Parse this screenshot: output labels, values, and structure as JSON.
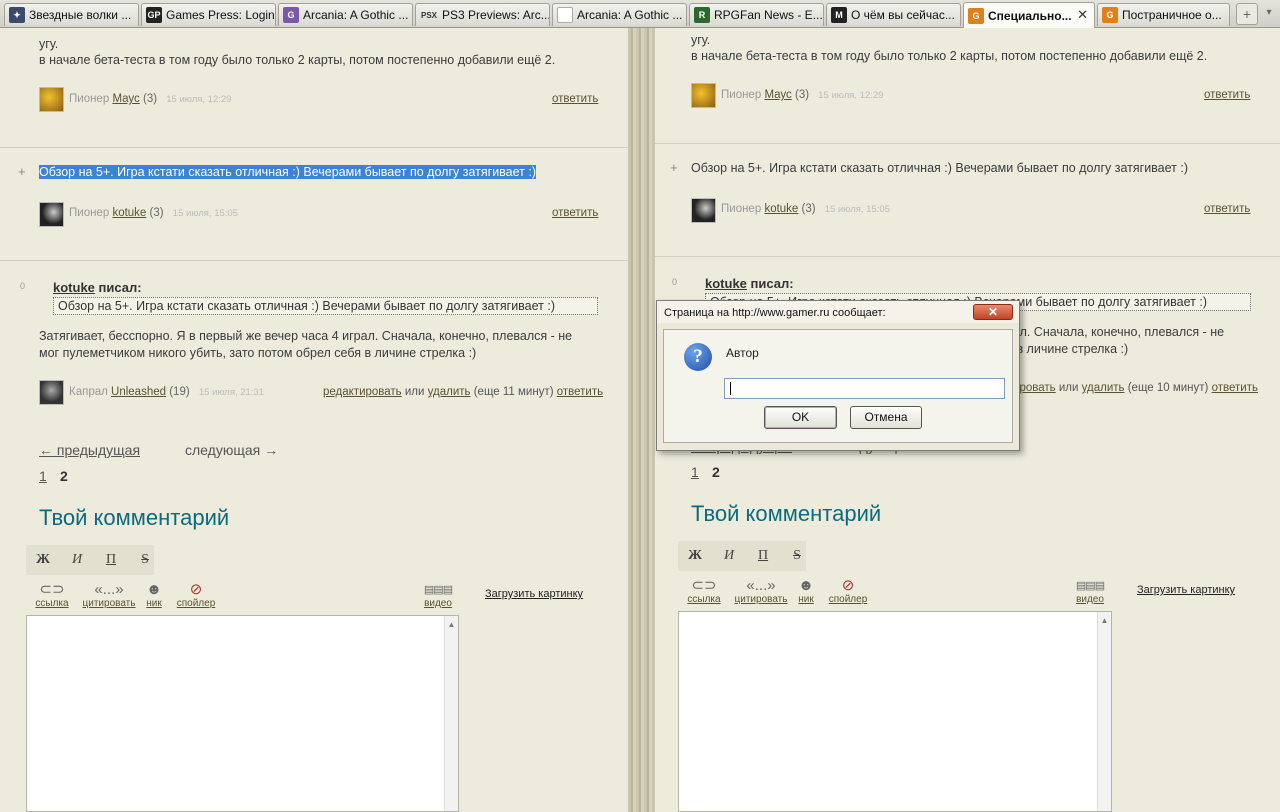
{
  "tabs": [
    {
      "title": "Звездные волки ...",
      "icon": "star-wolves-favicon-icon"
    },
    {
      "title": "Games Press: Login",
      "icon": "games-press-favicon-icon"
    },
    {
      "title": "Arcania: A Gothic ...",
      "icon": "arcania-favicon-icon"
    },
    {
      "title": "PS3 Previews: Arc...",
      "icon": "psx-favicon-icon",
      "icon_text": "PSX"
    },
    {
      "title": "Arcania: A Gothic ...",
      "icon": "blank-page-favicon-icon"
    },
    {
      "title": "RPGFan News - E...",
      "icon": "rpgfan-favicon-icon"
    },
    {
      "title": "О чём вы сейчас...",
      "icon": "forum-favicon-icon"
    },
    {
      "title": "Специально...",
      "icon": "gamer-favicon-icon",
      "active": true
    },
    {
      "title": "Постраничное о...",
      "icon": "gamer-favicon-icon"
    }
  ],
  "new_tab_symbol": "+",
  "tab_list_symbol": "▾",
  "close_symbol": "✕",
  "page": {
    "comment1": {
      "text_line1": "угу.",
      "text_line2": "в начале бета-теста в том году было только 2 карты, потом постепенно добавили ещё 2.",
      "rank": "Пионер",
      "user": "Маус",
      "count": "(3)",
      "date": "15 июля, 12:29",
      "reply": "ответить"
    },
    "comment2": {
      "plus": "+",
      "text": "Обзор на 5+. Игра кстати сказать отличная :) Вечерами бывает по долгу затягивает :)",
      "rank": "Пионер",
      "user": "kotuke",
      "count": "(3)",
      "date": "15 июля, 15:05",
      "reply": "ответить"
    },
    "comment3": {
      "score": "0",
      "quote_user": "kotuke",
      "quote_wrote": "писал:",
      "quote_text": "Обзор на 5+. Игра кстати сказать отличная :) Вечерами бывает по долгу затягивает :)",
      "text_line1": "Затягивает, бесспорно. Я в первый же вечер часа 4 играл. Сначала, конечно, плевался - не",
      "text_line2": "мог пулеметчиком никого убить, зато потом обрел себя в личине стрелка :)",
      "rank": "Капрал",
      "user": "Unleashed",
      "count": "(19)",
      "date": "15 июля, 21:31",
      "edit": "редактировать",
      "or": "или",
      "delete": "удалить",
      "left_time_left": "(еще 11 минут)",
      "left_time_right": "(еще 10 минут)",
      "reply": "ответить"
    },
    "nav": {
      "prev": "← предыдущая",
      "next": "следующая →",
      "page1": "1",
      "page2": "2"
    },
    "comment_form": {
      "heading": "Твой комментарий",
      "format": {
        "bold": "Ж",
        "italic": "И",
        "underline": "П",
        "strike": "S"
      },
      "tools": {
        "link": "ссылка",
        "quote": "цитировать",
        "quote_icon_text": "«...»",
        "nick": "ник",
        "spoiler": "спойлер",
        "video": "видео"
      },
      "upload": "Загрузить картинку"
    }
  },
  "dialog": {
    "title": "Страница на http://www.gamer.ru сообщает:",
    "close": "✕",
    "question_mark": "?",
    "label": "Автор",
    "input_value": "",
    "ok": "OK",
    "cancel": "Отмена"
  },
  "colors": {
    "page_bg": "#ecebdc",
    "heading": "#0d6a7e",
    "link": "#5a5234",
    "selection": "#3c83d6"
  }
}
